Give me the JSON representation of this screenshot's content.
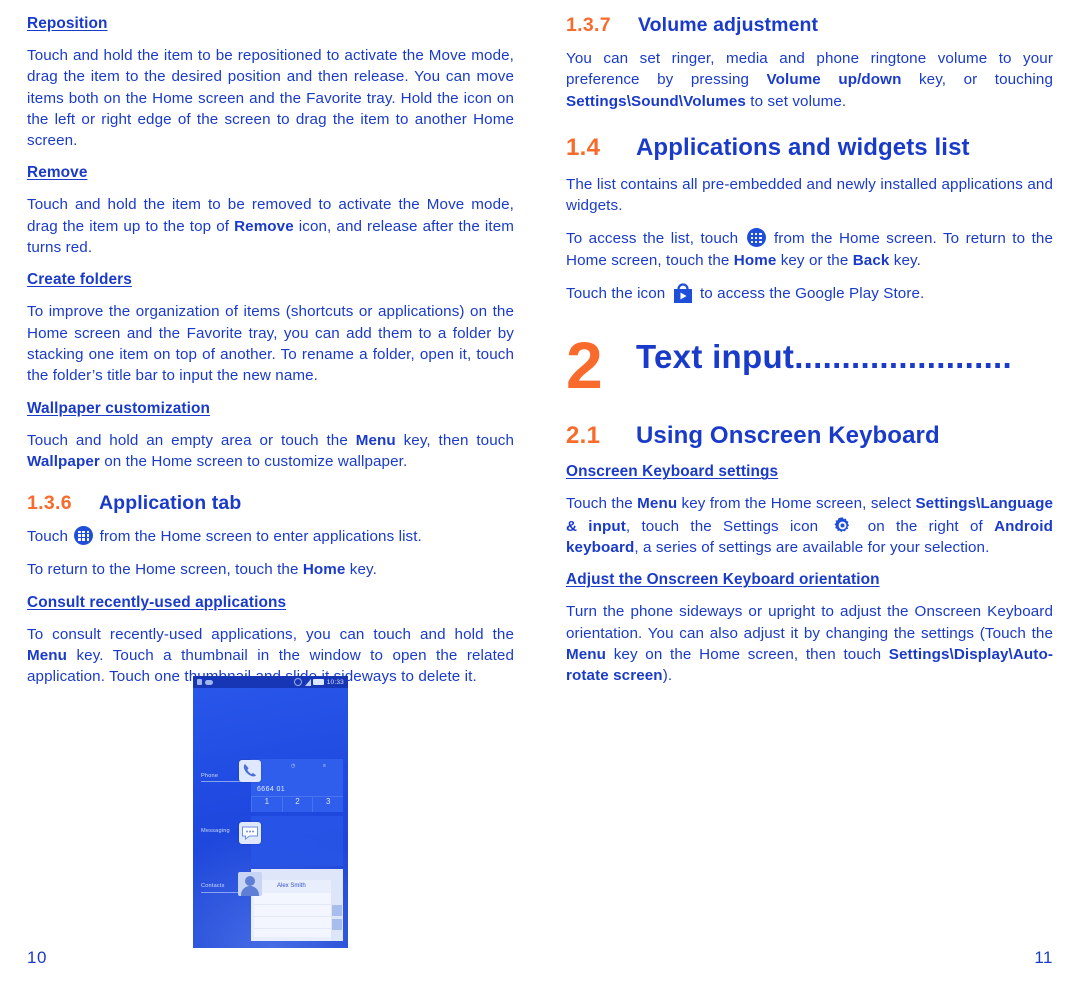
{
  "colors": {
    "blue": "#1a3bc9",
    "orange": "#f96b2c",
    "phone_screen": "#1f49e0"
  },
  "left_column": {
    "reposition": {
      "heading": "Reposition ",
      "paragraph_pre": "Touch and hold the item to be repositioned to activate the Move mode, drag the item to the desired position and then release. You can move items both on the Home screen and the Favorite tray. Hold the icon on the left or right edge of the screen to drag the item to another Home screen."
    },
    "remove": {
      "heading": "Remove",
      "part1": "Touch and hold the item to be removed to activate the Move mode, drag the item up to the top of ",
      "bold1": "Remove",
      "part2": " icon, and release after the item turns red."
    },
    "create_folders": {
      "heading": "Create folders",
      "paragraph": "To improve the organization of items (shortcuts or applications) on the Home screen and the Favorite tray, you can add them to a folder by stacking one item on top of another. To rename a folder, open it, touch the folder’s title bar to input the new name."
    },
    "wallpaper": {
      "heading": "Wallpaper customization",
      "part1": "Touch and hold an empty area or touch the ",
      "bold1": "Menu",
      "part2": " key,  then touch ",
      "bold2": "Wallpaper",
      "part3": " on the Home screen to customize wallpaper."
    },
    "application_tab": {
      "number": "1.3.6",
      "title": "Application tab",
      "line1_pre": "Touch ",
      "line1_icon": "apps-drawer-icon",
      "line1_post": " from the Home screen to enter applications list.",
      "line2_pre": "To return to the Home screen, touch the ",
      "line2_bold": "Home",
      "line2_post": " key."
    },
    "consult_recent": {
      "heading": "Consult recently-used applications",
      "part1": "To consult recently-used applications, you can touch and hold the ",
      "bold1": "Menu",
      "part2": " key. Touch a thumbnail in the window to open the related application. Touch one thumbnail and slide it sideways to delete it."
    },
    "figure": {
      "name": "recent-apps-screenshot",
      "status_time": "10:33",
      "thumbnails": [
        {
          "label": "Phone",
          "number_display": "6664 01",
          "keys": [
            "1",
            "2",
            "3"
          ]
        },
        {
          "label": "Messaging"
        },
        {
          "label": "Contacts",
          "contact_name": "Alex Smith"
        }
      ]
    },
    "page_number": "10"
  },
  "right_column": {
    "volume": {
      "number": "1.3.7",
      "title": "Volume adjustment",
      "part1": "You can set ringer, media and phone ringtone volume to your preference by pressing ",
      "bold1": "Volume up/down",
      "part2": " key, or touching ",
      "bold2": "Settings\\Sound\\Volumes",
      "part3": " to set volume."
    },
    "apps_widgets": {
      "number": "1.4",
      "title": "Applications and widgets list",
      "p1": "The list contains all pre-embedded and newly installed applications and widgets.",
      "p2_pre": "To access the list, touch ",
      "p2_icon": "apps-drawer-icon",
      "p2_mid": " from the Home screen. To return to the Home screen, touch the ",
      "p2_bold1": "Home",
      "p2_mid2": " key or the ",
      "p2_bold2": "Back",
      "p2_post": " key.",
      "p3_pre": "Touch the icon ",
      "p3_icon": "google-play-icon",
      "p3_post": " to access the Google Play Store."
    },
    "chapter": {
      "number": "2",
      "title": "Text input",
      "leader": "......................."
    },
    "onscreen_kb": {
      "number": "2.1",
      "title": "Using Onscreen Keyboard"
    },
    "kb_settings": {
      "heading": "Onscreen Keyboard settings",
      "part1": "Touch the ",
      "bold1": "Menu",
      "part2": " key from the Home screen, select ",
      "bold2": "Settings\\Language & input",
      "part3": ", touch the Settings icon ",
      "icon": "gear-icon",
      "part4": " on the right of ",
      "bold3": "Android keyboard",
      "part5": ", a series of settings are available for your selection."
    },
    "kb_orientation": {
      "heading": "Adjust the Onscreen Keyboard orientation",
      "part1": "Turn the phone sideways or upright to adjust the Onscreen Keyboard orientation. You can also adjust it by changing the settings (Touch the ",
      "bold1": "Menu",
      "part2": " key on the Home screen, then touch ",
      "bold2": "Settings\\Display\\Auto-rotate screen",
      "part3": ")."
    },
    "page_number": "11"
  }
}
